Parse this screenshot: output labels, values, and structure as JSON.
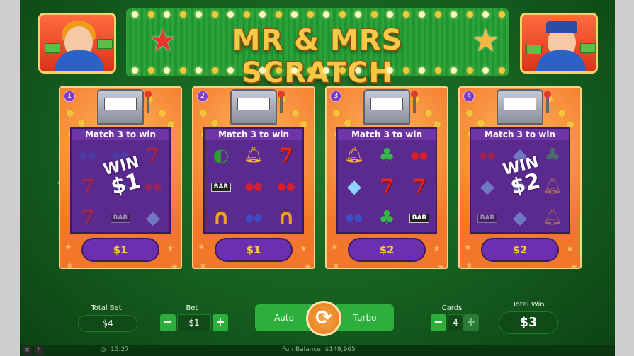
{
  "game": {
    "title": "MR & MRS SCRATCH"
  },
  "cards": [
    {
      "number": "1",
      "header": "Match 3 to win",
      "price": "$1",
      "win_line1": "WIN",
      "win_line2": "$1",
      "symbols": [
        "blueberry-icon",
        "blueberry-icon",
        "seven-icon",
        "seven-icon",
        "blueberry-icon",
        "cherry-icon",
        "seven-icon",
        "bar-icon",
        "diamond-icon"
      ]
    },
    {
      "number": "2",
      "header": "Match 3 to win",
      "price": "$1",
      "win_line1": "",
      "win_line2": "",
      "symbols": [
        "watermelon-icon",
        "bell-icon",
        "seven-icon",
        "bar-icon",
        "cherry-icon",
        "cherry-icon",
        "horseshoe-icon",
        "blueberry-icon",
        "horseshoe-icon"
      ]
    },
    {
      "number": "3",
      "header": "Match 3 to win",
      "price": "$2",
      "win_line1": "",
      "win_line2": "",
      "symbols": [
        "bell-icon",
        "clover-icon",
        "cherry-icon",
        "diamond-icon",
        "seven-icon",
        "seven-icon",
        "blueberry-icon",
        "clover-icon",
        "bar-icon"
      ]
    },
    {
      "number": "4",
      "header": "Match 3 to win",
      "price": "$2",
      "win_line1": "WIN",
      "win_line2": "$2",
      "symbols": [
        "cherry-icon",
        "diamond-icon",
        "clover-icon",
        "diamond-icon",
        "diamond-icon",
        "bell-icon",
        "bar-icon",
        "diamond-icon",
        "bell-icon"
      ]
    }
  ],
  "controls": {
    "total_bet_label": "Total Bet",
    "total_bet_value": "$4",
    "bet_label": "Bet",
    "bet_value": "$1",
    "bet_minus": "−",
    "bet_plus": "+",
    "auto_label": "Auto",
    "turbo_label": "Turbo",
    "cards_label": "Cards",
    "cards_value": "4",
    "cards_minus": "−",
    "cards_plus": "+",
    "total_win_label": "Total Win",
    "total_win_value": "$3"
  },
  "footer": {
    "time": "15:27",
    "balance": "Fun Balance: $149,965"
  },
  "colors": {
    "background_green": "#155e1f",
    "card_orange": "#f2772a",
    "panel_purple": "#5b2a8f",
    "price_gold": "#f7c948"
  }
}
